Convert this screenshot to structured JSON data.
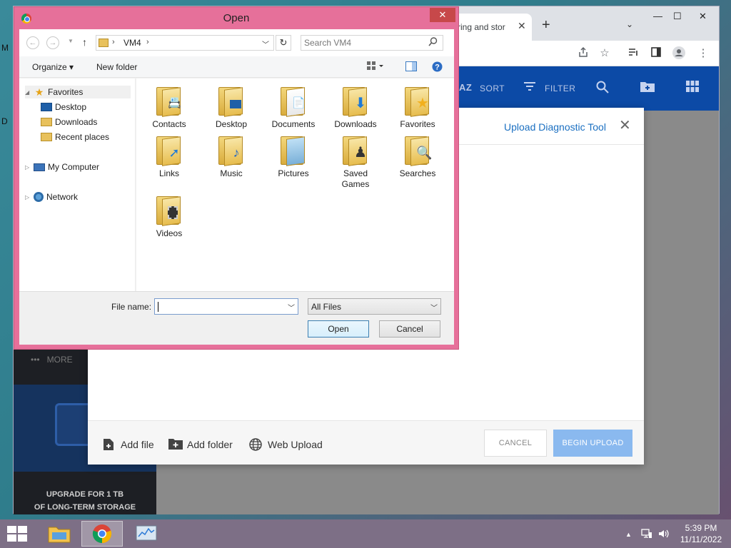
{
  "desktop": {
    "edge_letters": [
      "M",
      "D"
    ]
  },
  "browser": {
    "tab_title": "ring and stor",
    "tab_close": "✕",
    "new_tab": "+",
    "tab_search": "⌄",
    "window_controls": {
      "minimize": "—",
      "maximize": "☐",
      "close": "✕"
    },
    "toolbar_icons": [
      "share-icon",
      "star-icon",
      "reading-list-icon",
      "side-panel-icon",
      "profile-icon",
      "menu-icon"
    ]
  },
  "app_header": {
    "sort_label": "SORT",
    "sort_icon_text": "AZ",
    "filter_label": "FILTER"
  },
  "app_sidebar": {
    "more_label": "MORE",
    "more_dots": "•••",
    "upgrade_text_line1": "UPGRADE FOR 1 TB",
    "upgrade_text_line2": "OF LONG-TERM STORAGE"
  },
  "upload_modal": {
    "title": "Upload Diagnostic Tool",
    "close": "✕",
    "add_file": "Add file",
    "add_folder": "Add folder",
    "web_upload": "Web Upload",
    "cancel": "CANCEL",
    "begin_upload": "BEGIN UPLOAD",
    "colors": {
      "accent": "#1a6fc1",
      "begin_button": "#8ab9ef",
      "header": "#0c4aa6"
    }
  },
  "open_dialog": {
    "title": "Open",
    "close": "✕",
    "address_path": "VM4",
    "search_placeholder": "Search VM4",
    "organize_label": "Organize ▾",
    "new_folder_label": "New folder",
    "nav_tree": [
      {
        "label": "Favorites",
        "icon": "star-icon",
        "selected": true
      },
      {
        "label": "Desktop",
        "icon": "desktop-icon"
      },
      {
        "label": "Downloads",
        "icon": "downloads-icon"
      },
      {
        "label": "Recent places",
        "icon": "recent-places-icon"
      },
      {
        "label": "My Computer",
        "icon": "computer-icon"
      },
      {
        "label": "Network",
        "icon": "network-icon"
      }
    ],
    "files": [
      {
        "label": "Contacts",
        "badge": "contacts-icon"
      },
      {
        "label": "Desktop",
        "badge": "desktop-icon"
      },
      {
        "label": "Documents",
        "badge": "documents-icon"
      },
      {
        "label": "Downloads",
        "badge": "download-arrow-icon"
      },
      {
        "label": "Favorites",
        "badge": "star-icon"
      },
      {
        "label": "Links",
        "badge": "link-arrow-icon"
      },
      {
        "label": "Music",
        "badge": "music-note-icon"
      },
      {
        "label": "Pictures",
        "badge": "picture-icon"
      },
      {
        "label": "Saved Games",
        "badge": "chess-piece-icon"
      },
      {
        "label": "Searches",
        "badge": "magnifier-icon"
      },
      {
        "label": "Videos",
        "badge": "film-icon"
      }
    ],
    "file_name_label": "File name:",
    "file_name_value": "",
    "file_type_value": "All Files",
    "open_button": "Open",
    "cancel_button": "Cancel",
    "colors": {
      "frame": "#e6709a"
    }
  },
  "taskbar": {
    "items": [
      "file-explorer",
      "google-chrome",
      "task-manager"
    ],
    "time": "5:39 PM",
    "date": "11/11/2022"
  }
}
